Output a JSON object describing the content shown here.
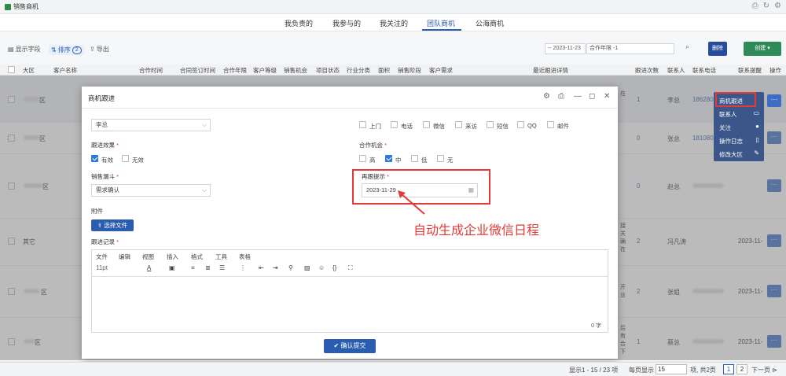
{
  "app": {
    "tab_title": "销售商机"
  },
  "nav": {
    "tabs": [
      "我负责的",
      "我参与的",
      "我关注的",
      "团队商机",
      "公海商机"
    ],
    "active_index": 3
  },
  "toolbar": {
    "display_fields": "显示字段",
    "sort_label": "排序",
    "sort_count": "2",
    "export_label": "导出",
    "date_filter": "-- 2023-11-23",
    "cooperation_filter": "合作年限 -1",
    "search_button": "删除",
    "create_button": "创建"
  },
  "table": {
    "headers": [
      "大区",
      "客户名称",
      "合作时间",
      "合同签订时间",
      "合作年限",
      "客户等级",
      "销售机会",
      "项目状态",
      "行业分类",
      "面积",
      "销售阶段",
      "客户需求",
      "最近跟进详情",
      "跟进次数",
      "联系人",
      "联系电话",
      "联系提醒",
      "操作"
    ],
    "rows": [
      {
        "region": "区",
        "follow_count": "1",
        "contact": "李总",
        "phone": "186280",
        "remind": ""
      },
      {
        "region": "区",
        "follow_count": "0",
        "contact": "张总",
        "phone": "181080",
        "remind": ""
      },
      {
        "region": "区",
        "follow_count": "0",
        "contact": "赵总",
        "phone": "",
        "remind": ""
      },
      {
        "region": "其它",
        "follow_count": "2",
        "contact": "冯凡涛",
        "phone": "",
        "remind": "2023-11-"
      },
      {
        "region": "区",
        "follow_count": "2",
        "contact": "张姐",
        "phone": "",
        "remind": "2023-11-"
      },
      {
        "region": "区",
        "follow_count": "1",
        "contact": "蔡总",
        "phone": "",
        "remind": "2023-11-"
      }
    ],
    "detail_snippets": [
      "接",
      "关",
      "确",
      "在",
      "开",
      "业",
      "后",
      "在",
      "有",
      "合",
      "下"
    ]
  },
  "context_menu": {
    "items": [
      "商机跟进",
      "联系人",
      "关注",
      "操作日志",
      "修改大区"
    ]
  },
  "modal": {
    "title": "商机跟进",
    "contact_select": "李总",
    "channels": [
      "上门",
      "电话",
      "微信",
      "来访",
      "短信",
      "QQ",
      "邮件"
    ],
    "effect_label": "跟进效果",
    "effect_options": [
      {
        "label": "有效",
        "checked": true
      },
      {
        "label": "无效",
        "checked": false
      }
    ],
    "chance_label": "合作机会",
    "chance_options": [
      {
        "label": "高",
        "checked": false
      },
      {
        "label": "中",
        "checked": true
      },
      {
        "label": "低",
        "checked": false
      },
      {
        "label": "无",
        "checked": false
      }
    ],
    "stage_label": "销售漏斗",
    "stage_select": "需求确认",
    "remind_label": "再跟提示",
    "remind_date": "2023-11-29",
    "attachment_label": "附件",
    "file_button": "选择文件",
    "record_label": "跟进记录",
    "editor_menu": [
      "文件",
      "编辑",
      "视图",
      "插入",
      "格式",
      "工具",
      "表格"
    ],
    "font_size": "11pt",
    "char_count": "0 字",
    "submit_button": "确认提交"
  },
  "annotation": "自动生成企业微信日程",
  "pager": {
    "summary": "显示1 - 15 / 23 项",
    "per_page_label": "每页显示",
    "per_page": "15",
    "total_pages": "项, 共2页",
    "page1": "1",
    "page2": "2",
    "next": "下一页"
  },
  "colors": {
    "primary": "#2a5db0",
    "create": "#2e8b57",
    "highlight": "#e53935",
    "menu": "#3b5688"
  }
}
